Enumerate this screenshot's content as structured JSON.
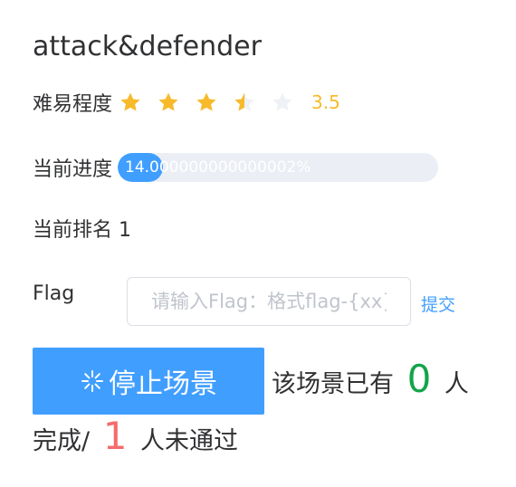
{
  "scenario": {
    "title": "attack&defender"
  },
  "difficulty": {
    "label": "难易程度",
    "rating": 3.5,
    "max": 5,
    "value_text": "3.5",
    "star_color": "#f7ba2a",
    "star_empty_color": "#eef1f6"
  },
  "progress": {
    "label": "当前进度",
    "percent": 14.000000000000002,
    "text": "14.000000000000002%",
    "fill_color": "#409eff",
    "track_color": "#ebeef5"
  },
  "rank": {
    "text": "当前排名 1"
  },
  "flag": {
    "label": "Flag",
    "placeholder": "请输入Flag：格式flag-{xx}",
    "value": "",
    "submit_label": "提交"
  },
  "stop_button": {
    "icon": "loading-spinner-icon",
    "label": "停止场景"
  },
  "completion": {
    "prefix": "该场景已有",
    "completed_count": "0",
    "unit1": "人",
    "completed_label": "完成/",
    "failed_count": "1",
    "failed_suffix": "人未通过"
  }
}
